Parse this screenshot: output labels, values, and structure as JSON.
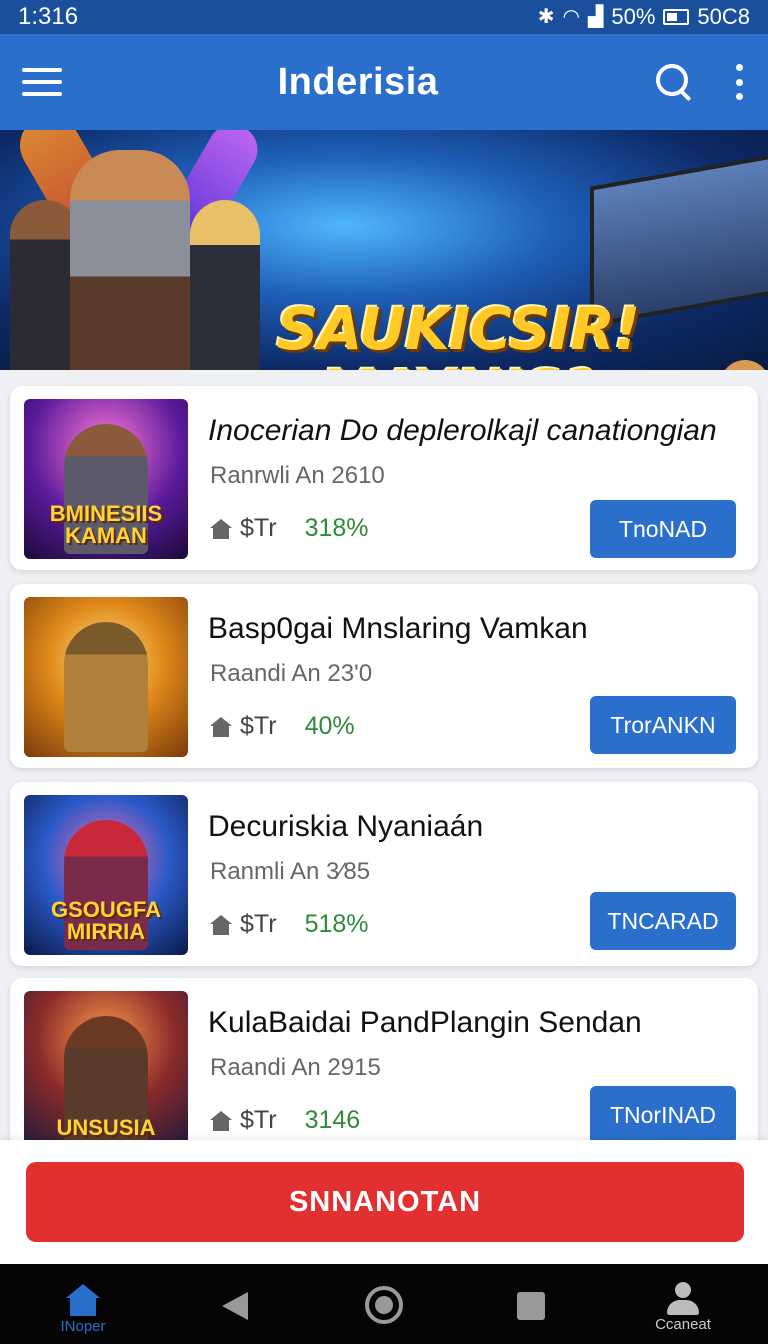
{
  "status_bar": {
    "time": "1:316",
    "bluetooth_icon": "bluetooth-icon",
    "wifi_icon": "wifi-icon",
    "signal_icon": "signal-icon",
    "battery_percent": "50%",
    "right_text": "50C8"
  },
  "app_bar": {
    "title": "Inderisia",
    "menu_icon": "hamburger-menu-icon",
    "search_icon": "search-icon",
    "more_icon": "more-vert-icon"
  },
  "banner": {
    "headline": "SAUKICSIR! MAYNIS?"
  },
  "games": [
    {
      "title": "Inocerian Do deplerolkajl canationgian",
      "meta": "Ranrwli An 2610",
      "price": "$Tr",
      "percent": "318%",
      "button": "TnoNAD",
      "thumb_text": "BMINESIIS KAMAN"
    },
    {
      "title": "Basp0gai Mnslaring Vamkan",
      "meta": "Raandi An 23'0",
      "price": "$Tr",
      "percent": "40%",
      "button": "TrorANKN",
      "thumb_text": ""
    },
    {
      "title": "Decuriskia Nyaniaán",
      "meta": "Ranmli An 3⁄85",
      "price": "$Tr",
      "percent": "518%",
      "button": "TNCARAD",
      "thumb_text": "GSOUGFA MIRRIA"
    },
    {
      "title": "KulaBaidai PandPlangin Sendan",
      "meta": "Raandi An 2915",
      "price": "$Tr",
      "percent": "3146",
      "button": "TNorINAD",
      "thumb_text": "UNSUSIA"
    }
  ],
  "cta": {
    "label": "SNNANOTAN"
  },
  "nav": {
    "home_label": "INoper",
    "account_label": "Ccaneat"
  },
  "colors": {
    "primary": "#2a6fcb",
    "status_bar": "#1a4f9c",
    "cta": "#e23030",
    "percent_green": "#2e8b3a"
  }
}
